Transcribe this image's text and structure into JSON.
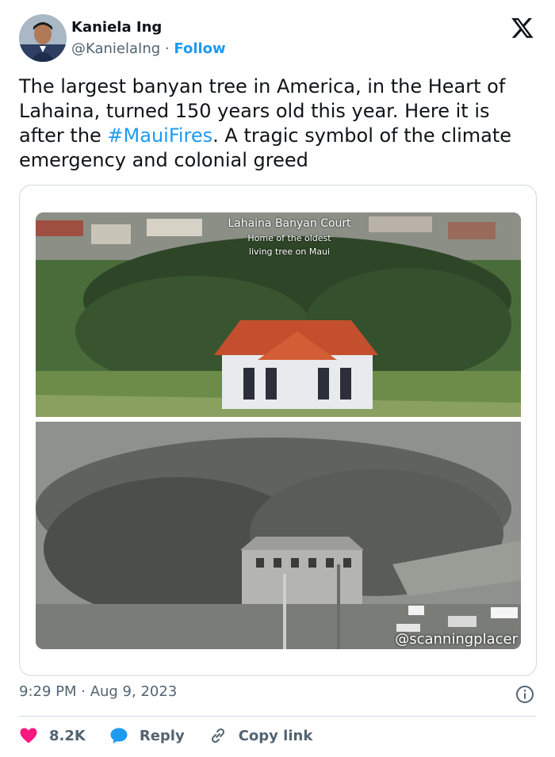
{
  "author": {
    "display_name": "Kaniela Ing",
    "handle": "@KanielaIng",
    "separator": "·",
    "follow_label": "Follow"
  },
  "tweet": {
    "text_before": "The largest banyan tree in America, in the Heart of Lahaina, turned 150 years old this year. Here it is after the ",
    "hashtag": "#MauiFires",
    "text_after": ". A tragic symbol of the climate emergency and colonial greed"
  },
  "media": {
    "top_caption_title": "Lahaina Banyan Court",
    "top_caption_line1": "Home of the oldest",
    "top_caption_line2": "living tree on Maui",
    "watermark": "@scanningplacer"
  },
  "meta": {
    "timestamp": "9:29 PM · Aug 9, 2023"
  },
  "actions": {
    "likes": "8.2K",
    "reply_label": "Reply",
    "copy_link_label": "Copy link"
  },
  "colors": {
    "accent": "#1d9bf0",
    "like": "#f91880",
    "text": "#0f1419",
    "muted": "#536471"
  }
}
